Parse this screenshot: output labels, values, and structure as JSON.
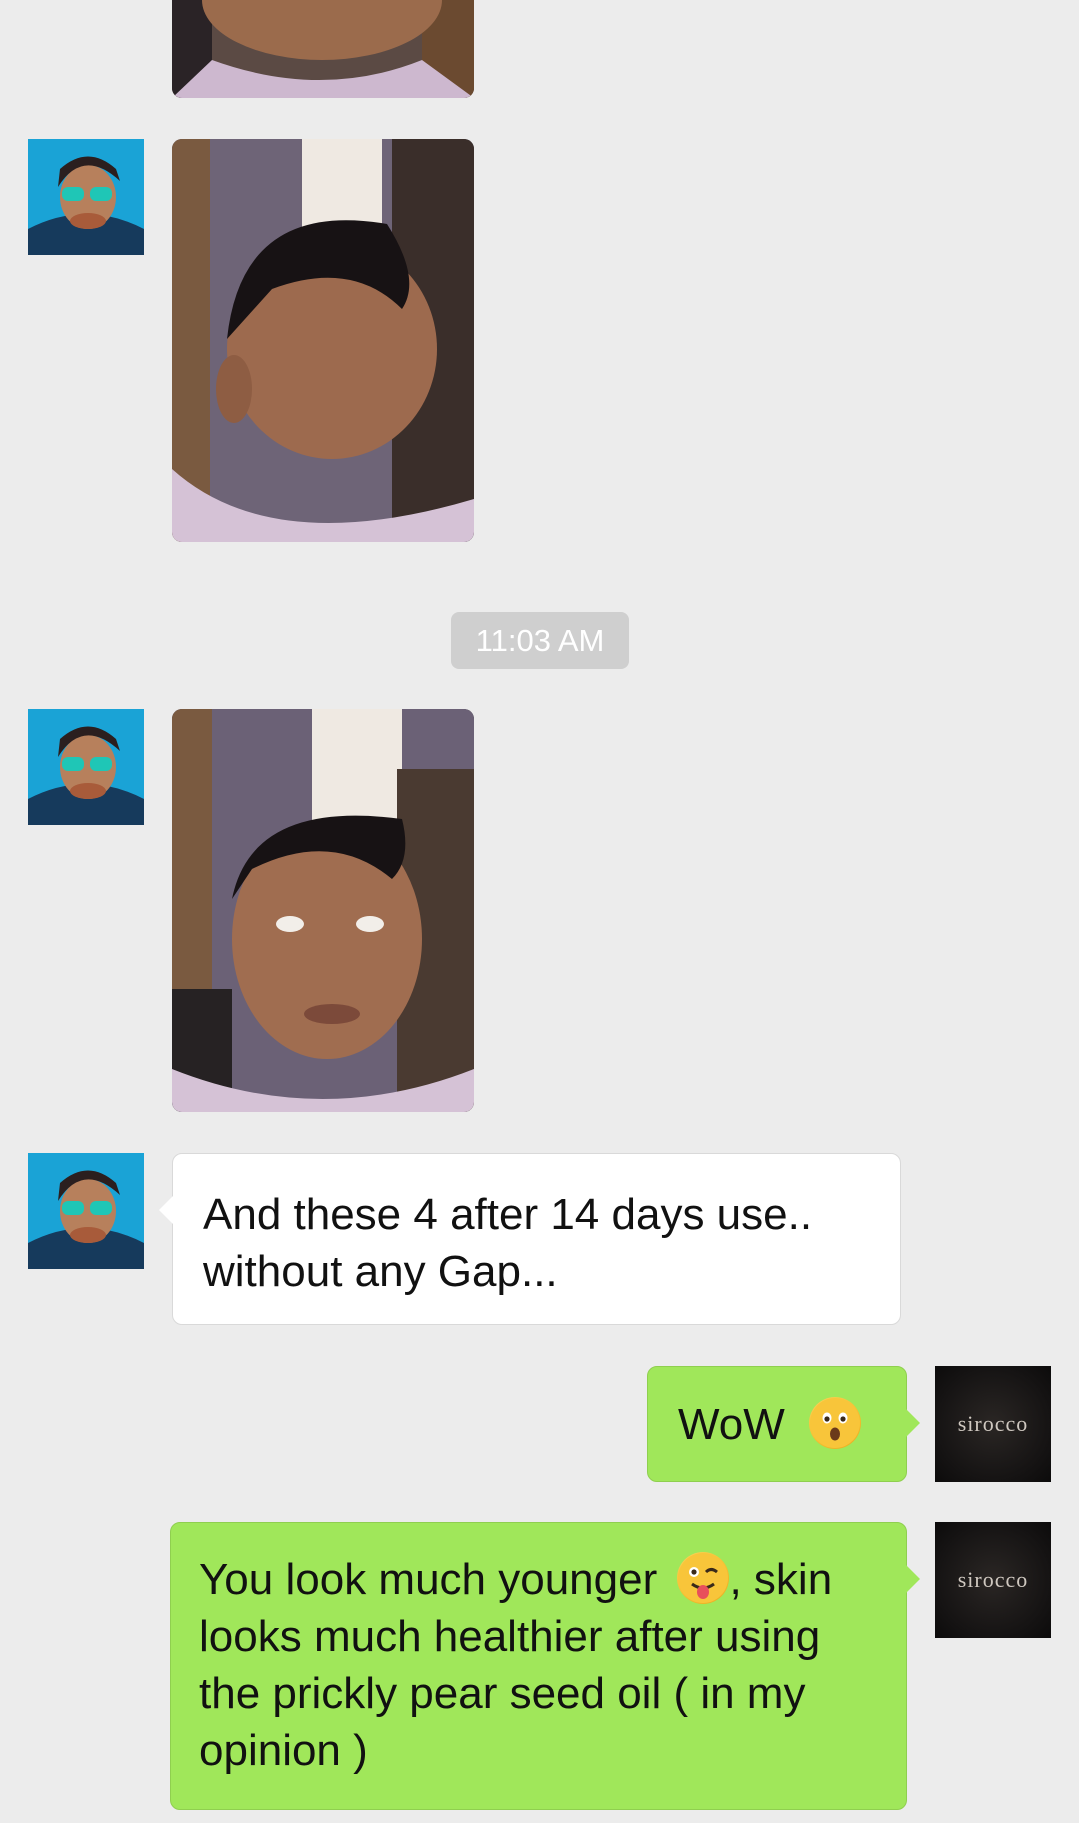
{
  "messages": {
    "timestamp": "11:03 AM",
    "received_text": {
      "line1": "And these 4 after 14 days use..",
      "line2": "without any Gap..."
    },
    "sent_wow": {
      "text": "WoW",
      "emoji": "astonished-face-emoji"
    },
    "sent_long": {
      "line1_a": "You look much younger",
      "emoji": "winking-tongue-face-emoji",
      "line1_b": ", skin",
      "line2": "looks much healthier after using",
      "line3": "the prickly pear seed oil ( in my",
      "line4": "opinion )"
    }
  },
  "contacts": {
    "self_avatar_label": "sirocco"
  },
  "colors": {
    "background": "#ececec",
    "sent_bubble": "#a0e75a",
    "received_bubble": "#ffffff",
    "timestamp_bg": "#cfcfcf"
  }
}
